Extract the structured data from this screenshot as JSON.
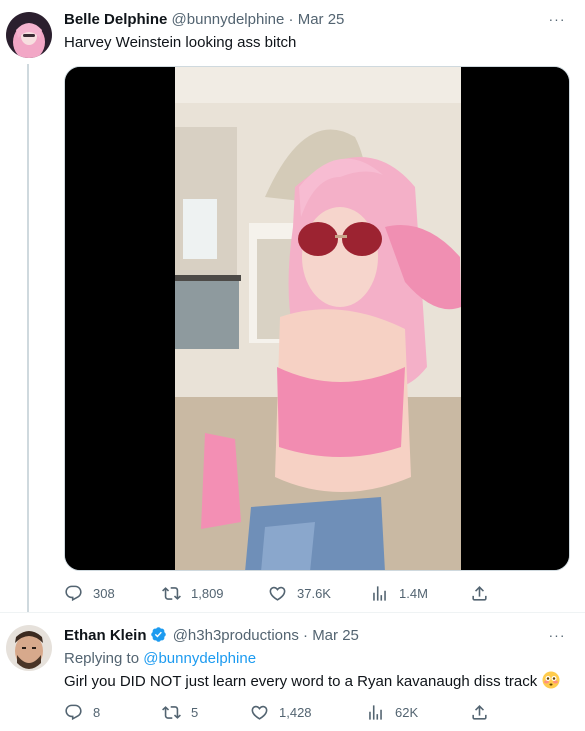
{
  "tweets": [
    {
      "author_name": "Belle Delphine",
      "handle": "@bunnydelphine",
      "separator": "·",
      "date": "Mar 25",
      "text": "Harvey Weinstein looking ass bitch",
      "stats": {
        "replies": "308",
        "retweets": "1,809",
        "likes": "37.6K",
        "views": "1.4M"
      }
    },
    {
      "author_name": "Ethan Klein",
      "handle": "@h3h3productions",
      "separator": "·",
      "date": "Mar 25",
      "replying_prefix": "Replying to",
      "replying_to": "@bunnydelphine",
      "text": "Girl you DID NOT just learn every word to a Ryan kavanaugh diss track",
      "stats": {
        "replies": "8",
        "retweets": "5",
        "likes": "1,428",
        "views": "62K"
      }
    }
  ],
  "more_glyph": "···",
  "icons": [
    "reply-icon",
    "retweet-icon",
    "like-icon",
    "views-icon",
    "share-icon",
    "more-icon",
    "verified-badge-icon",
    "flushed-emoji-icon"
  ],
  "colors": {
    "link": "#1d9bf0",
    "secondary_text": "#536471",
    "verified": "#1d9bf0",
    "thread_line": "#cfd9de"
  }
}
